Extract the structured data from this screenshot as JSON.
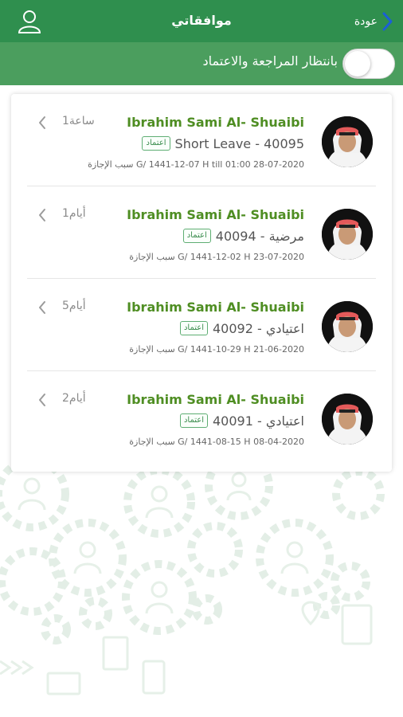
{
  "header": {
    "title": "موافقاتي",
    "back_label": "عودة"
  },
  "filter": {
    "label": "بانتظار المراجعة والاعتماد",
    "toggle_on": false
  },
  "colors": {
    "header_bg": "#2f8f4e",
    "filter_bg": "#4b9e5e",
    "name_green": "#4f8e23",
    "back_chevron": "#1a5fd6"
  },
  "requests": [
    {
      "name": "Ibrahim Sami Al- Shuaibi",
      "type_text": "Short Leave - 40095",
      "badge": "اعتماد",
      "detail": "سبب الإجازة G/ 1441-12-07 H till 01:00 28-07-2020",
      "time": "1ساعة"
    },
    {
      "name": "Ibrahim Sami Al- Shuaibi",
      "type_text": "40094 - مرضية",
      "badge": "اعتماد",
      "detail": "سبب الإجازة G/ 1441-12-02 H 23-07-2020",
      "time": "1أيام"
    },
    {
      "name": "Ibrahim Sami Al- Shuaibi",
      "type_text": "40092 - اعتيادي",
      "badge": "اعتماد",
      "detail": "سبب الإجازة G/ 1441-10-29 H 21-06-2020",
      "time": "5أيام"
    },
    {
      "name": "Ibrahim Sami Al- Shuaibi",
      "type_text": "40091 - اعتيادي",
      "badge": "اعتماد",
      "detail": "سبب الإجازة G/ 1441-08-15 H 08-04-2020",
      "time": "2أيام"
    }
  ]
}
